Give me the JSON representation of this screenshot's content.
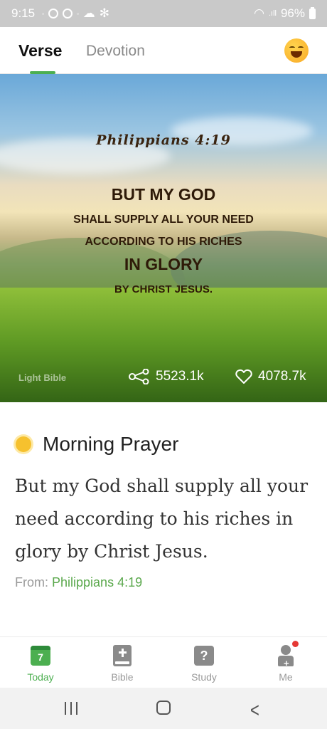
{
  "status_bar": {
    "time": "9:15",
    "battery": "96%"
  },
  "tabs": [
    {
      "label": "Verse",
      "active": true
    },
    {
      "label": "Devotion",
      "active": false
    }
  ],
  "hero": {
    "reference": "Philippians 4:19",
    "lines": [
      "BUT MY GOD",
      "SHALL SUPPLY ALL YOUR NEED",
      "ACCORDING TO HIS RICHES",
      "IN GLORY",
      "BY CHRIST JESUS."
    ],
    "watermark": "Light Bible",
    "share_count": "5523.1k",
    "like_count": "4078.7k"
  },
  "prayer": {
    "title": "Morning Prayer",
    "text": "But my God shall supply all your need according to his riches in glory by Christ Jesus.",
    "from_label": "From:",
    "from_source": "Philippians 4:19"
  },
  "bottom_nav": [
    {
      "label": "Today",
      "icon": "calendar-icon",
      "badge": "7",
      "active": true
    },
    {
      "label": "Bible",
      "icon": "bible-icon"
    },
    {
      "label": "Study",
      "icon": "question-icon",
      "badge": "?"
    },
    {
      "label": "Me",
      "icon": "profile-icon",
      "notification": true
    }
  ],
  "colors": {
    "accent": "#4caf50",
    "link": "#5aa84c",
    "notification": "#e53935"
  }
}
